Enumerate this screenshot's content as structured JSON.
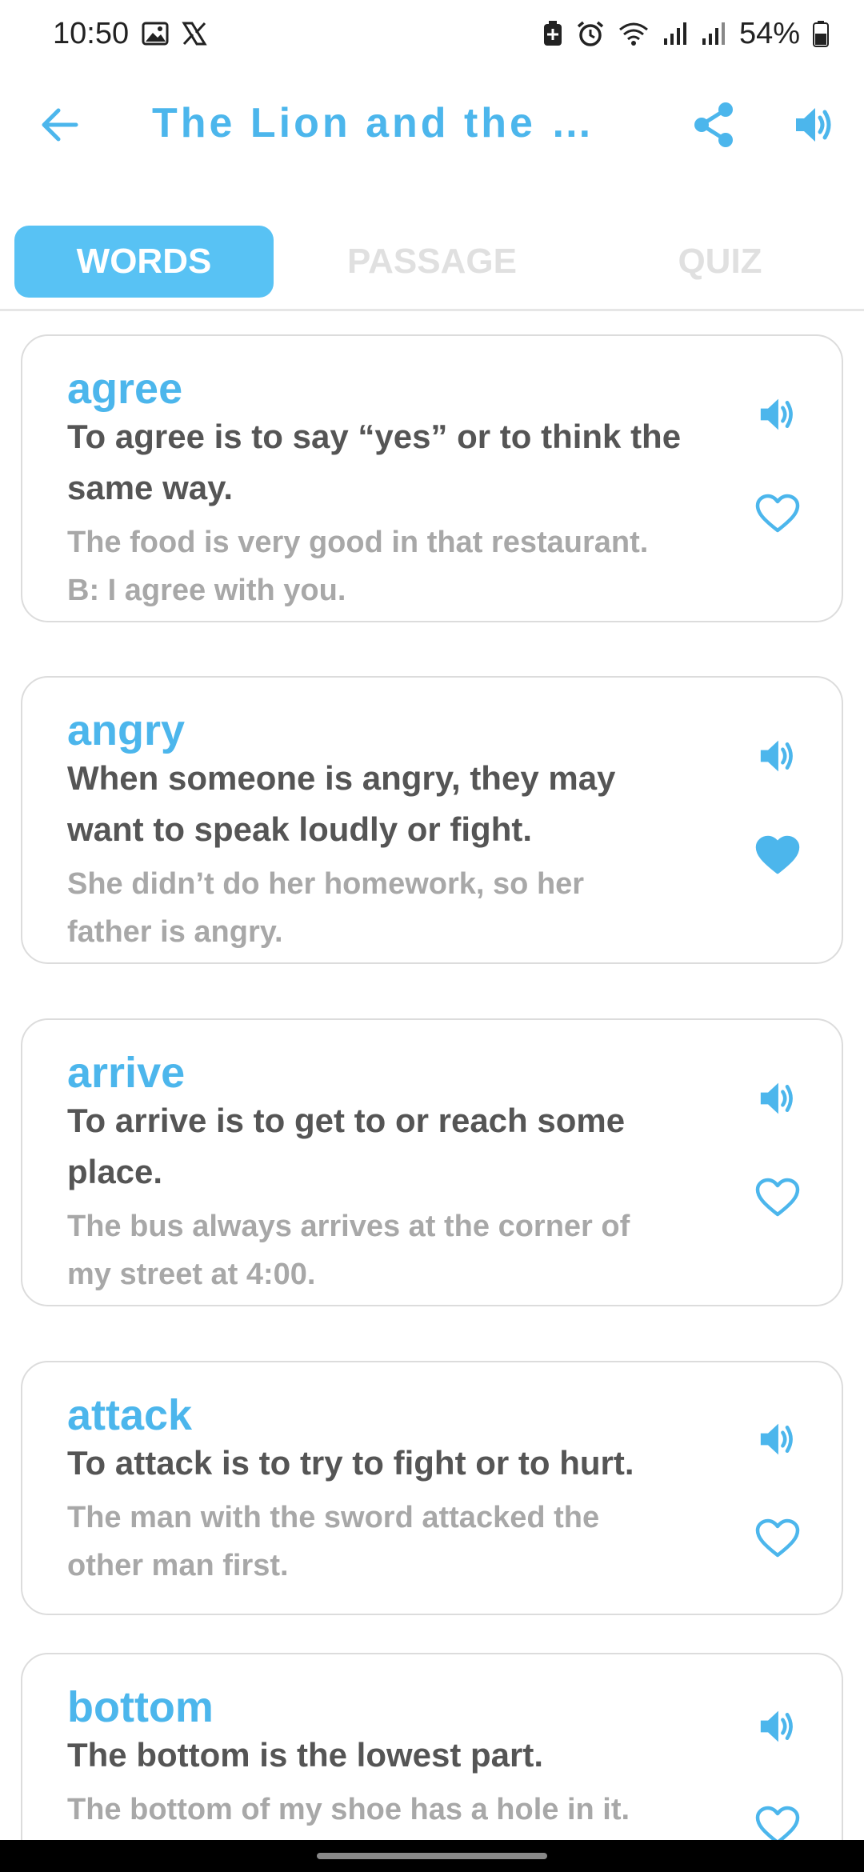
{
  "status_bar": {
    "time": "10:50",
    "battery": "54%",
    "icons": [
      "gallery-icon",
      "x-logo-icon",
      "battery-saver-icon",
      "alarm-icon",
      "wifi-icon",
      "signal-icon",
      "signal-icon",
      "battery-icon"
    ]
  },
  "header": {
    "title": "The Lion and the R…",
    "icons": [
      "back-arrow-icon",
      "share-icon",
      "speaker-icon"
    ]
  },
  "tabs": [
    {
      "label": "WORDS",
      "active": true
    },
    {
      "label": "PASSAGE",
      "active": false
    },
    {
      "label": "QUIZ",
      "active": false
    }
  ],
  "words": [
    {
      "term": "agree",
      "definition_lines": [
        "To agree is to say “yes” or to think the",
        "same way."
      ],
      "example_lines": [
        "The food is very good in that restaurant.",
        "B: I agree with you."
      ],
      "favorite": false
    },
    {
      "term": "angry",
      "definition_lines": [
        "When someone is angry, they may",
        "want to speak loudly or fight."
      ],
      "example_lines": [
        "She didn’t do her homework, so her",
        "father is angry."
      ],
      "favorite": true
    },
    {
      "term": "arrive",
      "definition_lines": [
        "To arrive is to get to or reach some",
        "place."
      ],
      "example_lines": [
        "The bus always arrives at the corner of",
        "my street at 4:00."
      ],
      "favorite": false
    },
    {
      "term": "attack",
      "definition_lines": [
        "To attack is to try to fight or to hurt."
      ],
      "example_lines": [
        "The man with the sword attacked the",
        "other man first."
      ],
      "favorite": false
    },
    {
      "term": "bottom",
      "definition_lines": [
        "The bottom is the lowest part."
      ],
      "example_lines": [
        "The bottom of my shoe has a hole in it."
      ],
      "favorite": false
    }
  ],
  "colors": {
    "accent": "#4cb6ec",
    "tab_active_bg": "#58c2f4",
    "definition_text": "#555555",
    "example_text": "#a8a8a8",
    "card_border": "#dcdcdc"
  }
}
